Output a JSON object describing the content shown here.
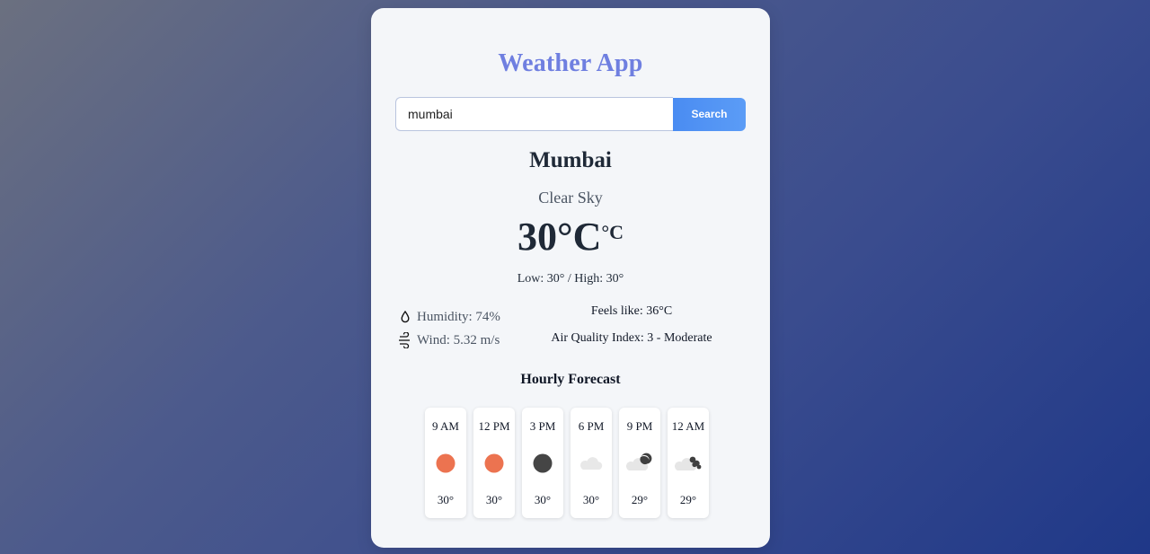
{
  "app": {
    "title": "Weather App"
  },
  "search": {
    "value": "mumbai",
    "button_label": "Search"
  },
  "current": {
    "city": "Mumbai",
    "condition": "Clear Sky",
    "temp": "30°C",
    "temp_unit": "°C",
    "low_high": "Low: 30° / High: 30°",
    "humidity": "Humidity: 74%",
    "wind": "Wind: 5.32 m/s",
    "feels_like": "Feels like: 36°C",
    "aqi": "Air Quality Index: 3 - Moderate"
  },
  "forecast": {
    "title": "Hourly Forecast",
    "items": [
      {
        "time": "9 AM",
        "temp": "30°",
        "icon": "sun-icon"
      },
      {
        "time": "12 PM",
        "temp": "30°",
        "icon": "sun-icon"
      },
      {
        "time": "3 PM",
        "temp": "30°",
        "icon": "moon-icon"
      },
      {
        "time": "6 PM",
        "temp": "30°",
        "icon": "cloud-icon"
      },
      {
        "time": "9 PM",
        "temp": "29°",
        "icon": "cloud-moon-icon"
      },
      {
        "time": "12 AM",
        "temp": "29°",
        "icon": "cloud-night-icon"
      }
    ]
  },
  "colors": {
    "title": "#6f7fe0",
    "button": "#4a8cf2",
    "sun": "#ec7350",
    "moon": "#454545",
    "cloud": "#e6e6e6"
  }
}
